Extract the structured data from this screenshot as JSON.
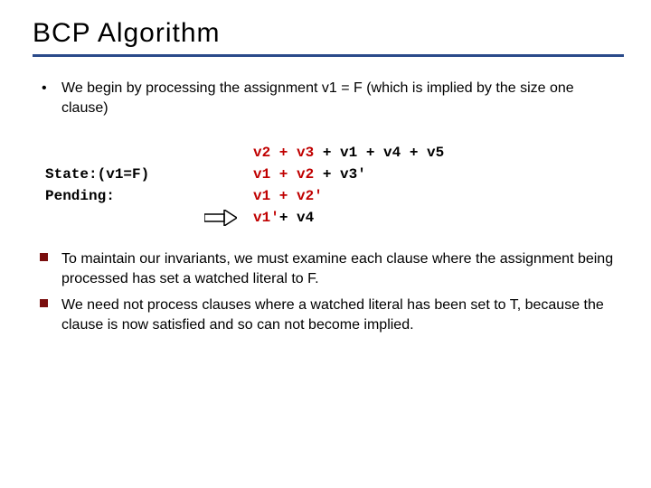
{
  "title": "BCP Algorithm",
  "intro_bullet": "We begin by processing the assignment v1 = F (which is implied by the size one clause)",
  "labels": {
    "state": "State:(v1=F)",
    "pending": "Pending:"
  },
  "clauses": {
    "c1_pre": "v2 + v3",
    "c1_post": " + v1 + v4 + v5",
    "c2_pre": "v1 + v2",
    "c2_post": " + v3'",
    "c3_pre": "v1 + v2'",
    "c4_pre": "v1'",
    "c4_post": "+ v4"
  },
  "notes": {
    "n1": "To maintain our invariants, we must examine each clause where the assignment being processed has set a watched literal to F.",
    "n2": "We need not process clauses where a watched literal has been set to T, because the clause is now satisfied and so can not become implied."
  }
}
